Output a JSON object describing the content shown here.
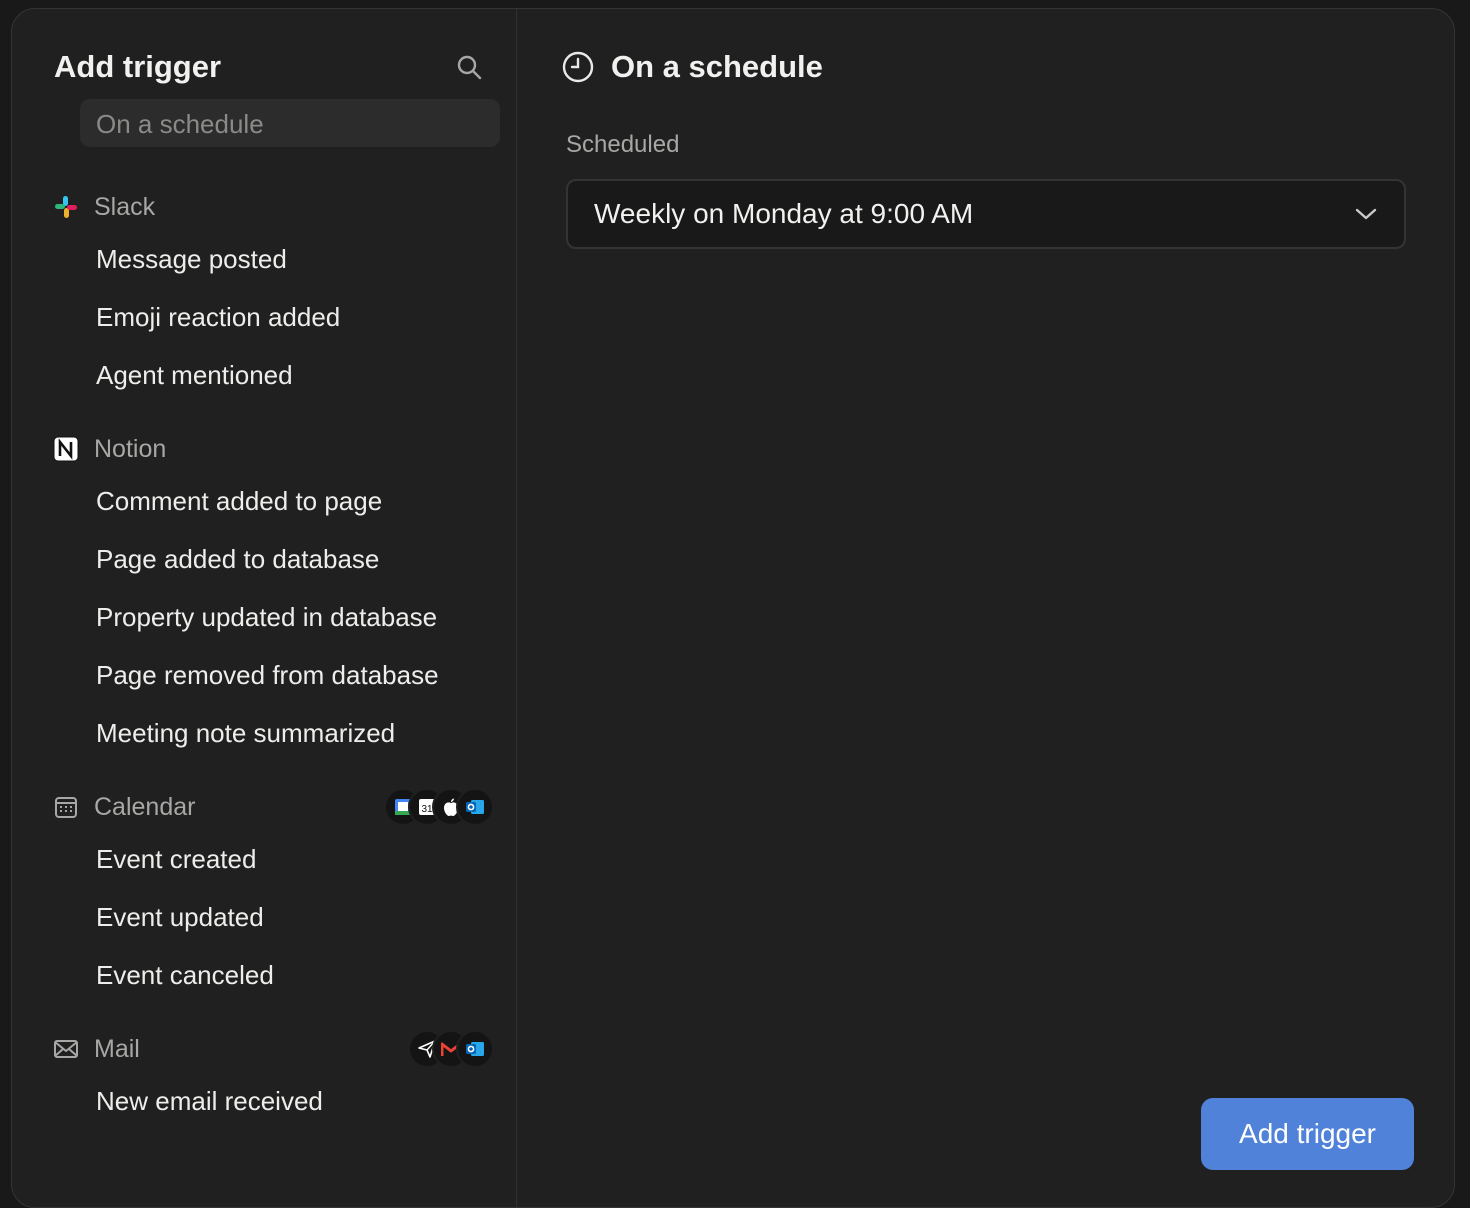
{
  "sidebar": {
    "title": "Add trigger",
    "selected_item": "On a schedule",
    "groups": [
      {
        "label": "Slack",
        "icon": "slack-icon",
        "items": [
          "Message posted",
          "Emoji reaction added",
          "Agent mentioned"
        ]
      },
      {
        "label": "Notion",
        "icon": "notion-icon",
        "items": [
          "Comment added to page",
          "Page added to database",
          "Property updated in database",
          "Page removed from database",
          "Meeting note summarized"
        ]
      },
      {
        "label": "Calendar",
        "icon": "calendar-icon",
        "items": [
          "Event created",
          "Event updated",
          "Event canceled"
        ]
      },
      {
        "label": "Mail",
        "icon": "mail-icon",
        "items": [
          "New email received"
        ]
      }
    ]
  },
  "main": {
    "title": "On a schedule",
    "field_label": "Scheduled",
    "schedule_value": "Weekly on Monday at 9:00 AM",
    "add_button": "Add trigger"
  },
  "colors": {
    "accent": "#4f82d8",
    "background": "#202020",
    "text": "#e9e9e7"
  }
}
